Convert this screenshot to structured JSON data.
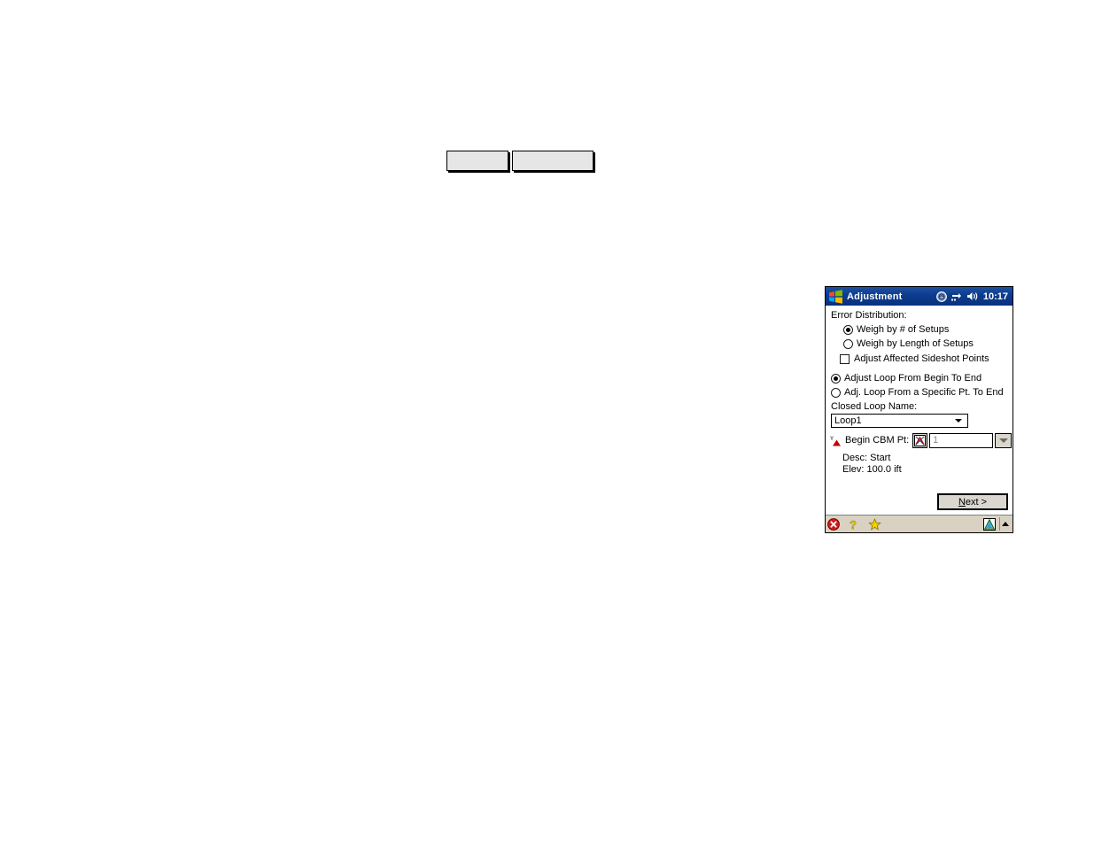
{
  "page": {
    "blank_buttons": [
      {
        "name": "blank-button-left",
        "label": ""
      },
      {
        "name": "blank-button-right",
        "label": ""
      }
    ]
  },
  "window": {
    "title_bar": {
      "logo_icon": "windows-logo-icon",
      "title": "Adjustment",
      "icons": [
        "connectivity-icon",
        "network-transfer-icon",
        "volume-icon"
      ],
      "clock": "10:17"
    },
    "content": {
      "error_distribution_label": "Error Distribution:",
      "options": [
        {
          "label": "Weigh by # of Setups",
          "type": "radio",
          "checked": true
        },
        {
          "label": "Weigh by Length of Setups",
          "type": "radio",
          "checked": false
        },
        {
          "label": "Adjust Affected Sideshot Points",
          "type": "checkbox",
          "checked": false
        }
      ],
      "loop_mode": [
        {
          "label": "Adjust Loop From Begin To End",
          "type": "radio",
          "checked": true
        },
        {
          "label": "Adj. Loop From a Specific Pt. To End",
          "type": "radio",
          "checked": false
        }
      ],
      "closed_loop_label": "Closed Loop Name:",
      "closed_loop_value": "Loop1",
      "cbm": {
        "icon": "benchmark-point-icon",
        "label": "Begin CBM Pt:",
        "pick_icon": "map-pick-point-icon",
        "value": "1",
        "spinner_icon": "chevron-down-icon"
      },
      "desc_line": "Desc: Start",
      "elev_line": "Elev: 100.0 ift",
      "next_button": {
        "accel": "N",
        "rest": "ext >"
      }
    },
    "toolbar": {
      "items": [
        {
          "name": "close-icon",
          "label": ""
        },
        {
          "name": "help-icon",
          "label": ""
        },
        {
          "name": "favorites-star-icon",
          "label": ""
        },
        {
          "name": "survey-app-icon",
          "label": ""
        },
        {
          "name": "scroll-up-icon",
          "label": ""
        }
      ]
    }
  },
  "colors": {
    "title_bar": "#0d3d90",
    "toolbar": "#d9d2c3",
    "button_face": "#d9d7cf",
    "close_red": "#d41a1a",
    "star_yellow": "#f5d000"
  }
}
